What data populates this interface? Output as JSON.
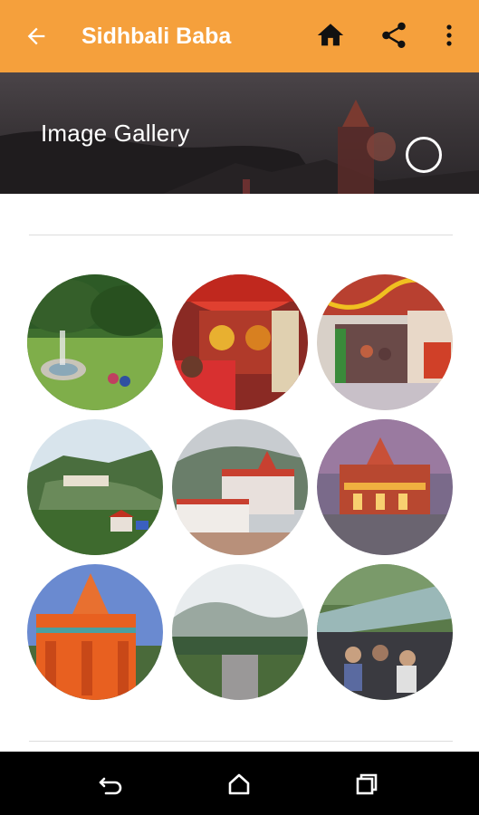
{
  "app_bar": {
    "title": "Sidhbali Baba",
    "color": "#f5a03c",
    "icons": [
      "back-arrow-icon",
      "home-icon",
      "share-icon",
      "more-vert-icon"
    ]
  },
  "hero": {
    "title": "Image Gallery"
  },
  "gallery": {
    "images": [
      {
        "name": "garden-fountain-photo"
      },
      {
        "name": "decorated-shrine-photo"
      },
      {
        "name": "temple-interior-crowd-photo"
      },
      {
        "name": "valley-landscape-photo"
      },
      {
        "name": "hillside-temple-photo"
      },
      {
        "name": "temple-evening-photo"
      },
      {
        "name": "orange-temple-tower-photo"
      },
      {
        "name": "misty-road-photo"
      },
      {
        "name": "canopy-crowd-photo"
      }
    ]
  },
  "nav_bar": {
    "icons": [
      "back-nav-icon",
      "home-nav-icon",
      "recents-nav-icon"
    ]
  }
}
